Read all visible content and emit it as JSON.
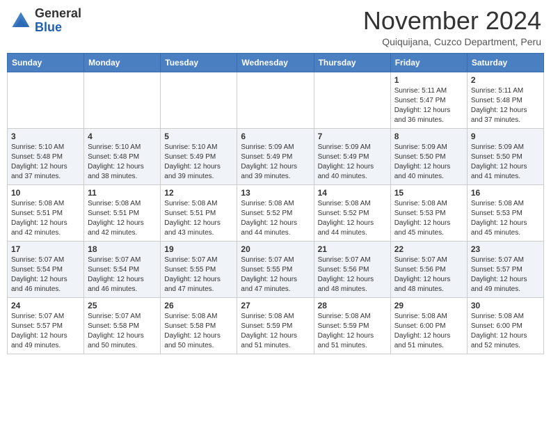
{
  "header": {
    "logo": {
      "line1": "General",
      "line2": "Blue"
    },
    "title": "November 2024",
    "location": "Quiquijana, Cuzco Department, Peru"
  },
  "calendar": {
    "weekdays": [
      "Sunday",
      "Monday",
      "Tuesday",
      "Wednesday",
      "Thursday",
      "Friday",
      "Saturday"
    ],
    "weeks": [
      [
        {
          "day": "",
          "info": ""
        },
        {
          "day": "",
          "info": ""
        },
        {
          "day": "",
          "info": ""
        },
        {
          "day": "",
          "info": ""
        },
        {
          "day": "",
          "info": ""
        },
        {
          "day": "1",
          "info": "Sunrise: 5:11 AM\nSunset: 5:47 PM\nDaylight: 12 hours\nand 36 minutes."
        },
        {
          "day": "2",
          "info": "Sunrise: 5:11 AM\nSunset: 5:48 PM\nDaylight: 12 hours\nand 37 minutes."
        }
      ],
      [
        {
          "day": "3",
          "info": "Sunrise: 5:10 AM\nSunset: 5:48 PM\nDaylight: 12 hours\nand 37 minutes."
        },
        {
          "day": "4",
          "info": "Sunrise: 5:10 AM\nSunset: 5:48 PM\nDaylight: 12 hours\nand 38 minutes."
        },
        {
          "day": "5",
          "info": "Sunrise: 5:10 AM\nSunset: 5:49 PM\nDaylight: 12 hours\nand 39 minutes."
        },
        {
          "day": "6",
          "info": "Sunrise: 5:09 AM\nSunset: 5:49 PM\nDaylight: 12 hours\nand 39 minutes."
        },
        {
          "day": "7",
          "info": "Sunrise: 5:09 AM\nSunset: 5:49 PM\nDaylight: 12 hours\nand 40 minutes."
        },
        {
          "day": "8",
          "info": "Sunrise: 5:09 AM\nSunset: 5:50 PM\nDaylight: 12 hours\nand 40 minutes."
        },
        {
          "day": "9",
          "info": "Sunrise: 5:09 AM\nSunset: 5:50 PM\nDaylight: 12 hours\nand 41 minutes."
        }
      ],
      [
        {
          "day": "10",
          "info": "Sunrise: 5:08 AM\nSunset: 5:51 PM\nDaylight: 12 hours\nand 42 minutes."
        },
        {
          "day": "11",
          "info": "Sunrise: 5:08 AM\nSunset: 5:51 PM\nDaylight: 12 hours\nand 42 minutes."
        },
        {
          "day": "12",
          "info": "Sunrise: 5:08 AM\nSunset: 5:51 PM\nDaylight: 12 hours\nand 43 minutes."
        },
        {
          "day": "13",
          "info": "Sunrise: 5:08 AM\nSunset: 5:52 PM\nDaylight: 12 hours\nand 44 minutes."
        },
        {
          "day": "14",
          "info": "Sunrise: 5:08 AM\nSunset: 5:52 PM\nDaylight: 12 hours\nand 44 minutes."
        },
        {
          "day": "15",
          "info": "Sunrise: 5:08 AM\nSunset: 5:53 PM\nDaylight: 12 hours\nand 45 minutes."
        },
        {
          "day": "16",
          "info": "Sunrise: 5:08 AM\nSunset: 5:53 PM\nDaylight: 12 hours\nand 45 minutes."
        }
      ],
      [
        {
          "day": "17",
          "info": "Sunrise: 5:07 AM\nSunset: 5:54 PM\nDaylight: 12 hours\nand 46 minutes."
        },
        {
          "day": "18",
          "info": "Sunrise: 5:07 AM\nSunset: 5:54 PM\nDaylight: 12 hours\nand 46 minutes."
        },
        {
          "day": "19",
          "info": "Sunrise: 5:07 AM\nSunset: 5:55 PM\nDaylight: 12 hours\nand 47 minutes."
        },
        {
          "day": "20",
          "info": "Sunrise: 5:07 AM\nSunset: 5:55 PM\nDaylight: 12 hours\nand 47 minutes."
        },
        {
          "day": "21",
          "info": "Sunrise: 5:07 AM\nSunset: 5:56 PM\nDaylight: 12 hours\nand 48 minutes."
        },
        {
          "day": "22",
          "info": "Sunrise: 5:07 AM\nSunset: 5:56 PM\nDaylight: 12 hours\nand 48 minutes."
        },
        {
          "day": "23",
          "info": "Sunrise: 5:07 AM\nSunset: 5:57 PM\nDaylight: 12 hours\nand 49 minutes."
        }
      ],
      [
        {
          "day": "24",
          "info": "Sunrise: 5:07 AM\nSunset: 5:57 PM\nDaylight: 12 hours\nand 49 minutes."
        },
        {
          "day": "25",
          "info": "Sunrise: 5:07 AM\nSunset: 5:58 PM\nDaylight: 12 hours\nand 50 minutes."
        },
        {
          "day": "26",
          "info": "Sunrise: 5:08 AM\nSunset: 5:58 PM\nDaylight: 12 hours\nand 50 minutes."
        },
        {
          "day": "27",
          "info": "Sunrise: 5:08 AM\nSunset: 5:59 PM\nDaylight: 12 hours\nand 51 minutes."
        },
        {
          "day": "28",
          "info": "Sunrise: 5:08 AM\nSunset: 5:59 PM\nDaylight: 12 hours\nand 51 minutes."
        },
        {
          "day": "29",
          "info": "Sunrise: 5:08 AM\nSunset: 6:00 PM\nDaylight: 12 hours\nand 51 minutes."
        },
        {
          "day": "30",
          "info": "Sunrise: 5:08 AM\nSunset: 6:00 PM\nDaylight: 12 hours\nand 52 minutes."
        }
      ]
    ]
  }
}
